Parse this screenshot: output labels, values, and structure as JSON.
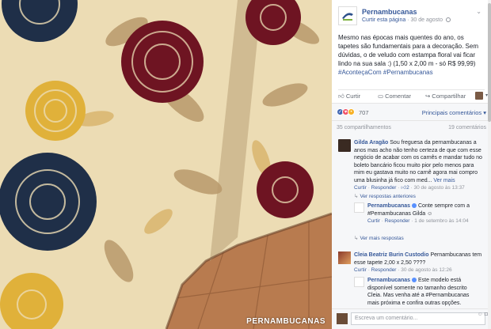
{
  "photo": {
    "watermark": "PERNAMBUCANAS"
  },
  "page": {
    "name": "Pernambucanas",
    "like_page": "Curtir esta página",
    "date": "30 de agosto"
  },
  "post": {
    "text": "Mesmo nas épocas mais quentes do ano, os tapetes são fundamentais para a decoração. Sem dúvidas, o de veludo com estampa floral vai ficar lindo na sua sala :) (1,50 x 2,00 m - só R$ 99,99)",
    "hashtags": "#AconteçaCom #Pernambucanas"
  },
  "actions": {
    "like": "Curtir",
    "comment": "Comentar",
    "share": "Compartilhar"
  },
  "reactions": {
    "count": "707",
    "top_comments": "Principais comentários"
  },
  "stats": {
    "shares": "35 compartilhamentos",
    "comments": "19 comentários"
  },
  "comments": [
    {
      "author": "Gilda Aragão",
      "text": "Sou freguesa da pernambucanas a anos mas acho não tenho certeza de que com esse negócio de acabar com os carnês e mandar tudo no boleto bancário ficou muito pior pelo menos para mim eu gastava muito no carnê agora mai compro uma blusinha já fico com med...",
      "more": "Ver mais",
      "meta_curtir": "Curtir",
      "meta_responder": "Responder",
      "likes": "2",
      "time": "30 de agosto às 13:37"
    },
    {
      "author": "Cleia Beatriz Burin Custodio",
      "text": "Pernambucanas tem esse tapete 2,00 x 2,50 ????",
      "meta_curtir": "Curtir",
      "meta_responder": "Responder",
      "time": "30 de agosto às 12:26"
    }
  ],
  "replies": [
    {
      "author": "Pernambucanas",
      "text": "Conte sempre com a #Pernambucanas Gilda",
      "meta_curtir": "Curtir",
      "meta_responder": "Responder",
      "time": "1 de setembro às 14:04"
    },
    {
      "author": "Pernambucanas",
      "text": "Este modelo está disponível somente no tamanho descrito Cleia. Mas venha até a #Pernambucanas mais próxima e confira outras opções."
    }
  ],
  "links": {
    "prev_replies": "Ver respostas anteriores",
    "more_replies": "Ver mais respostas"
  },
  "write": {
    "placeholder": "Escreva um comentário..."
  },
  "colors": {
    "link": "#365899",
    "meta": "#90949c",
    "panel_bg": "#f6f7f9"
  }
}
